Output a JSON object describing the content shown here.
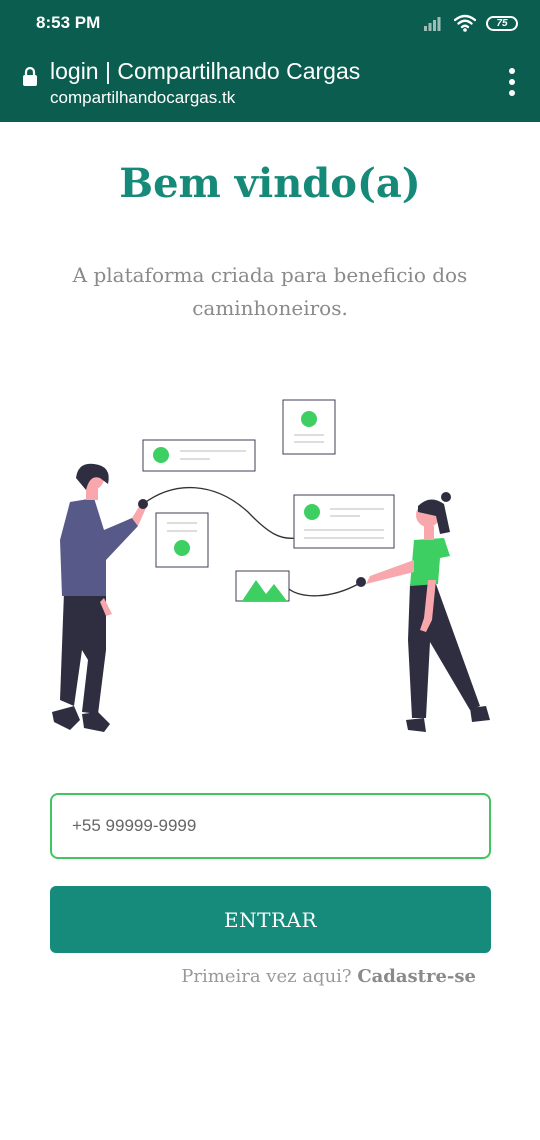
{
  "status_bar": {
    "time": "8:53 PM",
    "battery": "75"
  },
  "browser": {
    "page_title": "login | Compartilhando Cargas",
    "url": "compartilhandocargas.tk"
  },
  "main": {
    "welcome": "Bem vindo(a)",
    "subtitle": "A plataforma criada para beneficio dos caminhoneiros.",
    "phone_placeholder": "+55 99999-9999",
    "enter_label": "ENTRAR",
    "first_time_text": "Primeira vez aqui?",
    "signup_link": "Cadastre-se"
  },
  "colors": {
    "header": "#0b5e4f",
    "accent": "#168a78",
    "green": "#3ecf63"
  },
  "icons": [
    "signal-icon",
    "wifi-icon",
    "battery-icon",
    "lock-icon",
    "menu-icon"
  ]
}
